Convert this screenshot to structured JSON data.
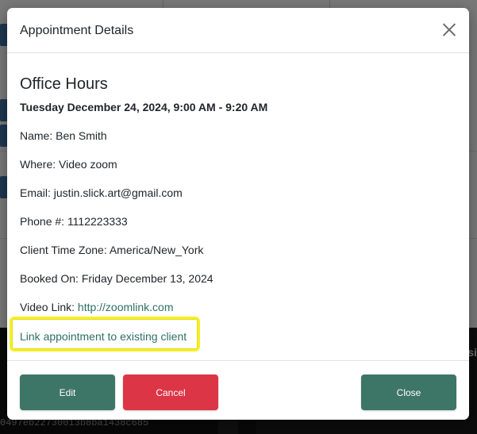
{
  "background": {
    "hash_text": "0497eb22730013b8ba1438c685",
    "peek_text": "si"
  },
  "modal": {
    "title": "Appointment Details",
    "appointment": {
      "name": "Office Hours",
      "when": "Tuesday December 24, 2024, 9:00 AM - 9:20 AM"
    },
    "fields": {
      "name": "Name: Ben Smith",
      "where": "Where: Video zoom",
      "email": "Email: justin.slick.art@gmail.com",
      "phone": "Phone #: 1112223333",
      "timezone": "Client Time Zone: America/New_York",
      "booked_on": "Booked On: Friday December 13, 2024",
      "video_label": "Video Link: ",
      "video_url": "http://zoomlink.com"
    },
    "link_existing_label": "Link appointment to existing client",
    "buttons": {
      "edit": "Edit",
      "cancel": "Cancel",
      "close": "Close"
    }
  },
  "colors": {
    "primary": "#3d7566",
    "danger": "#dc3545",
    "link": "#2e7063",
    "highlight": "#f5ef2a"
  }
}
